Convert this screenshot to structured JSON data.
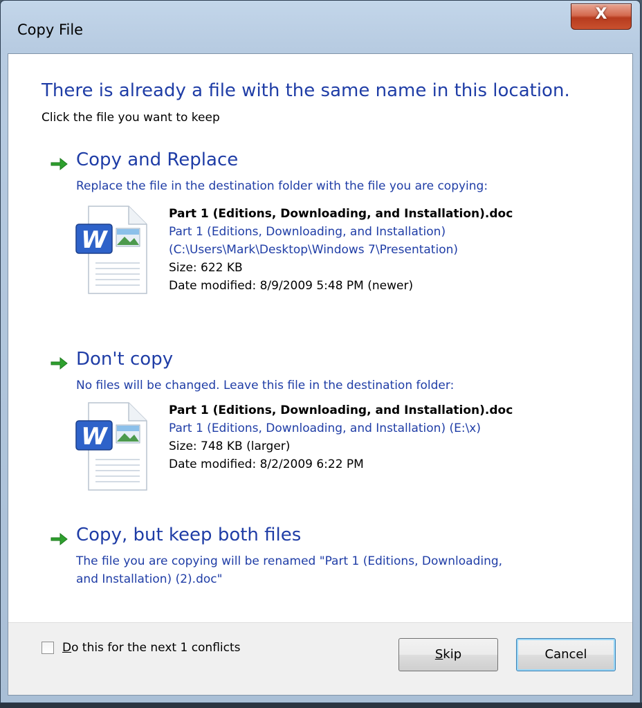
{
  "window": {
    "title": "Copy File",
    "close_glyph": "X"
  },
  "dialog": {
    "headline": "There is already a file with the same name in this location.",
    "subhead": "Click the file you want to keep"
  },
  "options": [
    {
      "title": "Copy and Replace",
      "description": "Replace the file in the destination folder with the file you are copying:",
      "file": {
        "name": "Part 1 (Editions, Downloading, and Installation).doc",
        "location_line1": "Part 1 (Editions, Downloading, and Installation)",
        "location_line2": "(C:\\Users\\Mark\\Desktop\\Windows 7\\Presentation)",
        "size": "Size: 622 KB",
        "date": "Date modified: 8/9/2009 5:48 PM (newer)"
      }
    },
    {
      "title": "Don't copy",
      "description": "No files will be changed. Leave this file in the destination folder:",
      "file": {
        "name": "Part 1 (Editions, Downloading, and Installation).doc",
        "location_line1": "Part 1 (Editions, Downloading, and Installation) (E:\\x)",
        "size": "Size: 748 KB (larger)",
        "date": "Date modified: 8/2/2009 6:22 PM"
      }
    },
    {
      "title": "Copy, but keep both files",
      "description_line1": "The file you are copying will be renamed \"Part 1 (Editions, Downloading,",
      "description_line2": "and Installation) (2).doc\""
    }
  ],
  "footer": {
    "checkbox_mnemonic": "D",
    "checkbox_rest": "o this for the next 1 conflicts",
    "checkbox_checked": false,
    "skip_mnemonic": "S",
    "skip_rest": "kip",
    "cancel_label": "Cancel"
  },
  "icons": {
    "option_arrow": "green-arrow-icon",
    "file": "word-document-icon"
  },
  "colors": {
    "link_blue": "#1f3da6",
    "arrow_green": "#2ea02e",
    "close_red": "#c9512f"
  }
}
